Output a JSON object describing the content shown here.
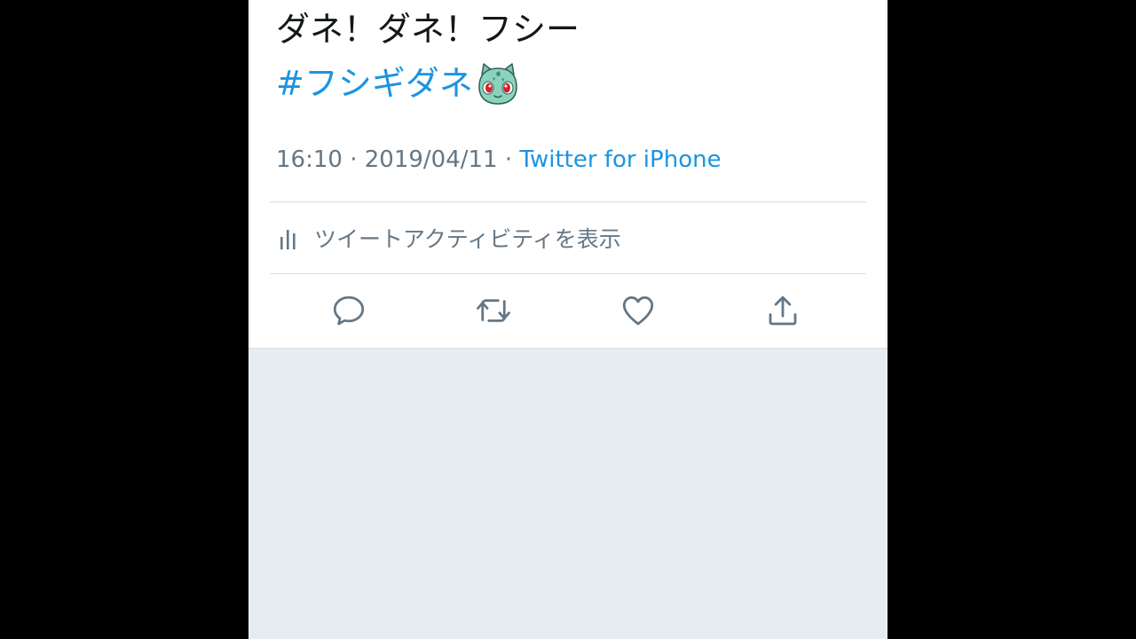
{
  "tweet": {
    "text_line1": "ダネ！ダネ！フシー",
    "hashtag": "#フシギダネ",
    "emoji_icon": "bulbasaur-face-emoji",
    "time": "16:10",
    "separator": " · ",
    "date": "2019/04/11",
    "source": "Twitter for iPhone"
  },
  "activity": {
    "icon": "bar-chart-icon",
    "label": "ツイートアクティビティを表示"
  },
  "actions": [
    {
      "name": "reply",
      "icon": "speech-bubble-icon"
    },
    {
      "name": "retweet",
      "icon": "retweet-arrows-icon"
    },
    {
      "name": "like",
      "icon": "heart-icon"
    },
    {
      "name": "share",
      "icon": "share-upload-icon"
    }
  ],
  "colors": {
    "link": "#1b95e0",
    "text": "#14171a",
    "secondary": "#657786",
    "icon": "#657786",
    "background": "#e6ecf0",
    "divider": "#d8dde1"
  }
}
